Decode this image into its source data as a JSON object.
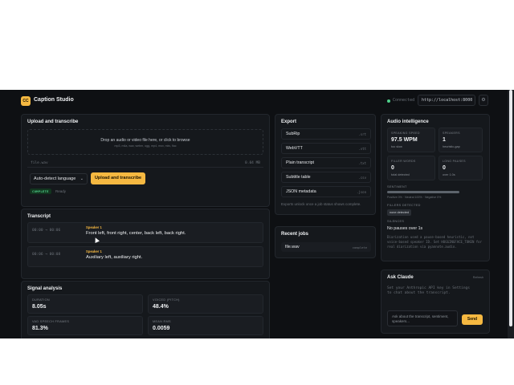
{
  "app": {
    "title": "Caption Studio",
    "logo_text": "CC"
  },
  "connection": {
    "status": "Connected",
    "url": "http://localhost:8000",
    "settings_icon": "gear-icon"
  },
  "upload": {
    "title": "Upload and transcribe",
    "dropzone_text": "Drop an audio or video file here, or click to browse",
    "dropzone_formats": "mp3, m4a, wav, webm, ogg, mp4, mov, mkv, flac",
    "file_name": "file.wav",
    "file_size": "0.04 MB",
    "language": "Auto-detect language",
    "button": "Upload and transcribe",
    "status_badge": "COMPLETE",
    "status_text": "Ready"
  },
  "transcript": {
    "title": "Transcript",
    "segments": [
      {
        "time": "00:00 → 00:06",
        "speaker": "Speaker 1",
        "text": "Front left, front right, center, back left, back right."
      },
      {
        "time": "00:06 → 00:08",
        "speaker": "Speaker 1",
        "text": "Auxiliary left, auxiliary right."
      }
    ]
  },
  "signal": {
    "title": "Signal analysis",
    "metrics": [
      {
        "label": "DURATION",
        "value": "8.05s"
      },
      {
        "label": "VOICED (PITCH)",
        "value": "48.4%"
      },
      {
        "label": "VAD SPEECH FRAMES",
        "value": "81.3%"
      },
      {
        "label": "MEAN RMS",
        "value": "0.0059"
      }
    ]
  },
  "export": {
    "title": "Export",
    "items": [
      {
        "label": "SubRip",
        "ext": ".srt"
      },
      {
        "label": "WebVTT",
        "ext": ".vtt"
      },
      {
        "label": "Plain transcript",
        "ext": ".txt"
      },
      {
        "label": "Subtitle table",
        "ext": ".csv"
      },
      {
        "label": "JSON metadata",
        "ext": ".json"
      }
    ],
    "hint": "Exports unlock once a job status shows complete."
  },
  "jobs": {
    "title": "Recent jobs",
    "items": [
      {
        "name": "file.wav",
        "state": "complete"
      }
    ]
  },
  "intelligence": {
    "title": "Audio intelligence",
    "cards": [
      {
        "label": "SPEAKING SPEED",
        "value": "97.5 WPM",
        "sub": "too slow"
      },
      {
        "label": "SPEAKERS",
        "value": "1",
        "sub": "heuristic-gap"
      },
      {
        "label": "FILLER WORDS",
        "value": "0",
        "sub": "total detected"
      },
      {
        "label": "LONG PAUSES",
        "value": "0",
        "sub": "over 1.0s"
      }
    ],
    "sentiment_label": "SENTIMENT",
    "sentiment_neutral": 1.0,
    "sentiment_legend": "Positive 0% · Neutral 100% · Negative 0%",
    "fillers_label": "FILLERS DETECTED",
    "fillers_chip": "none detected",
    "silences_label": "SILENCES",
    "silences_text": "No pauses over 1s",
    "diarization_note": "Diarization used a pause-based heuristic, not voice-based speaker ID. Set HUGGINGFACE_TOKEN for real diarization via pyannote.audio."
  },
  "claude": {
    "title": "Ask Claude",
    "reset": "Refresh",
    "hint": "Set your Anthropic API key in Settings to chat about the transcript.",
    "placeholder": "Ask about the transcript, sentiment, speakers...",
    "send": "Send"
  },
  "colors": {
    "accent": "#f5b841",
    "background": "#0e1013",
    "panel": "#15181c",
    "success": "#4fd18b"
  }
}
